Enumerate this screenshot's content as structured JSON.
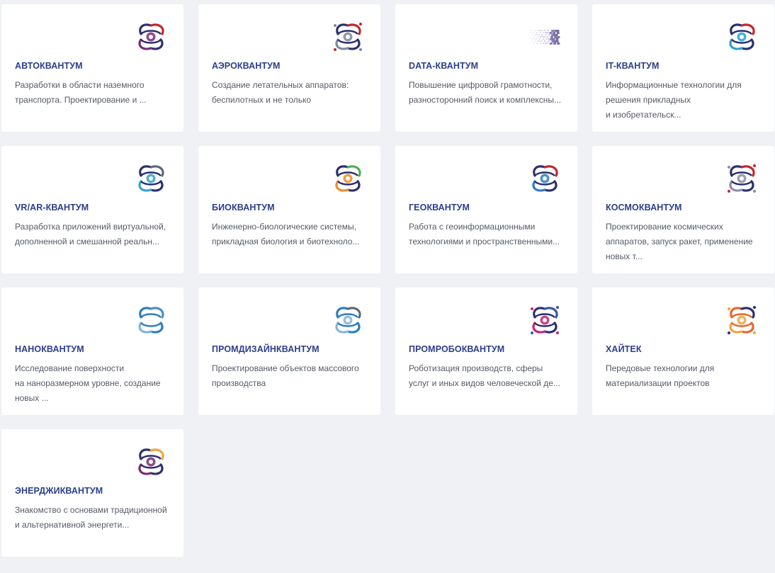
{
  "cards": [
    {
      "title": "АВТОКВАНТУМ",
      "desc": [
        "Разработки в области наземного",
        "транспорта. Проектирование и ..."
      ],
      "icon": "car-wheel-quantum-icon",
      "colors": [
        "#2b2f6e",
        "#c4262e",
        "#7a2a73"
      ]
    },
    {
      "title": "АЭРОКВАНТУМ",
      "desc": [
        "Создание летательных аппаратов:",
        "беспилотных и не только"
      ],
      "icon": "drone-quantum-icon",
      "colors": [
        "#2b2f6e",
        "#c4262e",
        "#7d8b9a"
      ]
    },
    {
      "title": "DATA-КВАНТУМ",
      "desc": [
        "Повышение цифровой грамотности,",
        "разносторонний поиск и комплексны..."
      ],
      "icon": "data-pixels-icon",
      "colors": [
        "#7b6fa8",
        "#b4a9cf",
        "#5a4f8c"
      ]
    },
    {
      "title": "IT-КВАНТУМ",
      "desc": [
        "Информационные технологии для",
        "решения прикладных",
        "и изобретательск..."
      ],
      "icon": "it-quantum-icon",
      "colors": [
        "#2b2f6e",
        "#c4262e",
        "#2e9fd0"
      ]
    },
    {
      "title": "VR/AR-КВАНТУМ",
      "desc": [
        "Разработка приложений виртуальной,",
        "дополненной и смешанной реальн..."
      ],
      "icon": "vr-headset-quantum-icon",
      "colors": [
        "#2b2f6e",
        "#5a6b7a",
        "#3a9fd0"
      ]
    },
    {
      "title": "БИОКВАНТУМ",
      "desc": [
        "Инженерно-биологические системы,",
        "прикладная биология и биотехноло..."
      ],
      "icon": "bio-quantum-icon",
      "colors": [
        "#2b2f6e",
        "#4caf50",
        "#f28c28"
      ]
    },
    {
      "title": "ГЕОКВАНТУМ",
      "desc": [
        "Работа с геоинформационными",
        "технологиями и пространственными..."
      ],
      "icon": "geo-quantum-icon",
      "colors": [
        "#2b2f6e",
        "#c4262e",
        "#2e7dc0"
      ]
    },
    {
      "title": "КОСМОКВАНТУМ",
      "desc": [
        "Проектирование космических",
        "аппаратов, запуск ракет, применение",
        "новых т..."
      ],
      "icon": "planet-quantum-icon",
      "colors": [
        "#2b2f6e",
        "#c4262e",
        "#8a8fa8"
      ]
    },
    {
      "title": "НАНОКВАНТУМ",
      "desc": [
        "Исследование поверхности",
        "на наноразмерном уровне, создание",
        "новых ..."
      ],
      "icon": "nano-quantum-icon",
      "colors": [
        "#2e7dc0",
        "#4a90c8",
        "#7fb3dc"
      ]
    },
    {
      "title": "ПРОМДИЗАЙНКВАНТУМ",
      "desc": [
        "Проектирование объектов массового",
        "производства"
      ],
      "icon": "design-quantum-icon",
      "colors": [
        "#2e7dc0",
        "#5a6b7a",
        "#8ab4d8"
      ]
    },
    {
      "title": "ПРОМРОБОКВАНТУМ",
      "desc": [
        "Роботизация производств, сферы",
        "услуг и иных видов человеческой де..."
      ],
      "icon": "robot-quantum-icon",
      "colors": [
        "#2b2f6e",
        "#3a56a8",
        "#c0267a"
      ]
    },
    {
      "title": "ХАЙТЕК",
      "desc": [
        "Передовые технологии для",
        "материализации проектов"
      ],
      "icon": "hitech-quantum-icon",
      "colors": [
        "#e8672a",
        "#2b2f6e",
        "#f2a341"
      ]
    },
    {
      "title": "ЭНЕРДЖИКВАНТУМ",
      "desc": [
        "Знакомство с основами традиционной",
        "и альтернативной энергети..."
      ],
      "icon": "energy-quantum-icon",
      "colors": [
        "#2b2f6e",
        "#f2a341",
        "#7a2a73"
      ]
    }
  ]
}
